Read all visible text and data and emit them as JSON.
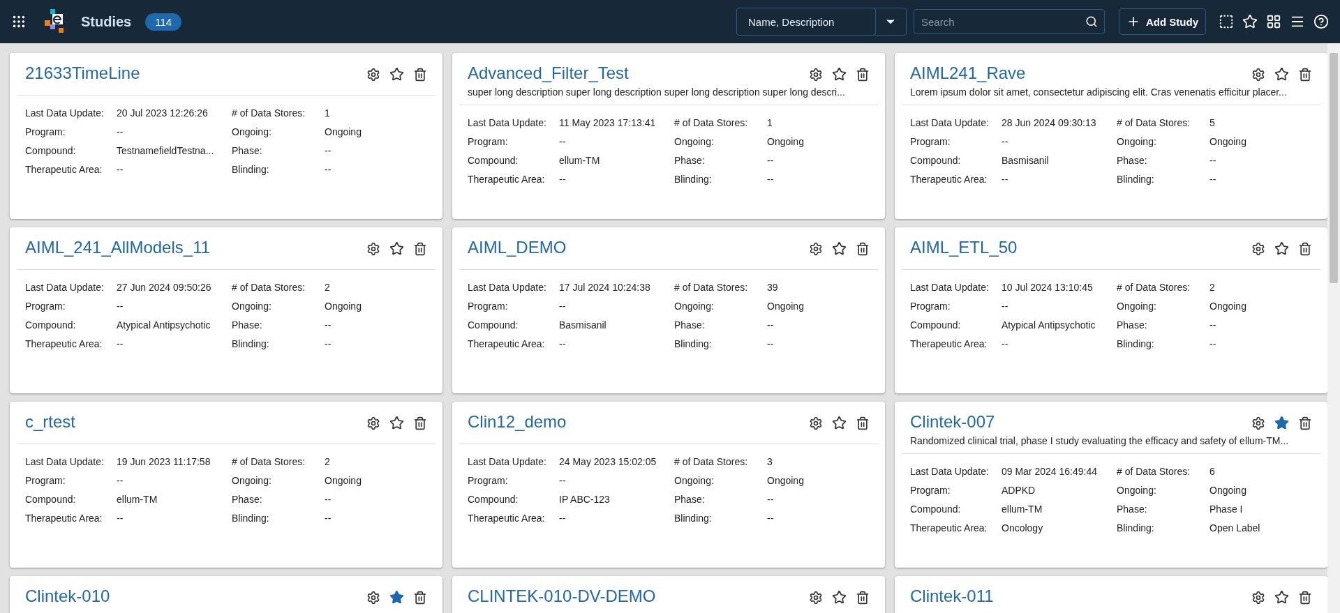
{
  "header": {
    "title": "Studies",
    "count": "114",
    "search_by": "Name, Description",
    "search": {
      "placeholder": "Search"
    },
    "add_button": "Add Study"
  },
  "cards": [
    {
      "title": "21633TimeLine",
      "favorite": false,
      "fields": [
        {
          "label": "Last Data Update:",
          "value": "20 Jul 2023 12:26:26"
        },
        {
          "label": "# of Data Stores:",
          "value": "1"
        },
        {
          "label": "Program:",
          "value": "--"
        },
        {
          "label": "Ongoing:",
          "value": "Ongoing"
        },
        {
          "label": "Compound:",
          "value": "TestnamefieldTestna..."
        },
        {
          "label": "Phase:",
          "value": "--"
        },
        {
          "label": "Therapeutic Area:",
          "value": "--"
        },
        {
          "label": "Blinding:",
          "value": "--"
        }
      ]
    },
    {
      "title": "Advanced_Filter_Test",
      "favorite": false,
      "description": "super long description super long description super long description super long descri...",
      "fields": [
        {
          "label": "Last Data Update:",
          "value": "11 May 2023 17:13:41"
        },
        {
          "label": "# of Data Stores:",
          "value": "1"
        },
        {
          "label": "Program:",
          "value": "--"
        },
        {
          "label": "Ongoing:",
          "value": "Ongoing"
        },
        {
          "label": "Compound:",
          "value": "ellum-TM"
        },
        {
          "label": "Phase:",
          "value": "--"
        },
        {
          "label": "Therapeutic Area:",
          "value": "--"
        },
        {
          "label": "Blinding:",
          "value": "--"
        }
      ]
    },
    {
      "title": "AIML241_Rave",
      "favorite": false,
      "description": "Lorem ipsum dolor sit amet, consectetur adipiscing elit. Cras venenatis efficitur placer...",
      "fields": [
        {
          "label": "Last Data Update:",
          "value": "28 Jun 2024 09:30:13"
        },
        {
          "label": "# of Data Stores:",
          "value": "5"
        },
        {
          "label": "Program:",
          "value": "--"
        },
        {
          "label": "Ongoing:",
          "value": "Ongoing"
        },
        {
          "label": "Compound:",
          "value": "Basmisanil"
        },
        {
          "label": "Phase:",
          "value": "--"
        },
        {
          "label": "Therapeutic Area:",
          "value": "--"
        },
        {
          "label": "Blinding:",
          "value": "--"
        }
      ]
    },
    {
      "title": "AIML_241_AllModels_11",
      "favorite": false,
      "fields": [
        {
          "label": "Last Data Update:",
          "value": "27 Jun 2024 09:50:26"
        },
        {
          "label": "# of Data Stores:",
          "value": "2"
        },
        {
          "label": "Program:",
          "value": "--"
        },
        {
          "label": "Ongoing:",
          "value": "Ongoing"
        },
        {
          "label": "Compound:",
          "value": "Atypical Antipsychotic"
        },
        {
          "label": "Phase:",
          "value": "--"
        },
        {
          "label": "Therapeutic Area:",
          "value": "--"
        },
        {
          "label": "Blinding:",
          "value": "--"
        }
      ]
    },
    {
      "title": "AIML_DEMO",
      "favorite": false,
      "fields": [
        {
          "label": "Last Data Update:",
          "value": "17 Jul 2024 10:24:38"
        },
        {
          "label": "# of Data Stores:",
          "value": "39"
        },
        {
          "label": "Program:",
          "value": "--"
        },
        {
          "label": "Ongoing:",
          "value": "Ongoing"
        },
        {
          "label": "Compound:",
          "value": "Basmisanil"
        },
        {
          "label": "Phase:",
          "value": "--"
        },
        {
          "label": "Therapeutic Area:",
          "value": "--"
        },
        {
          "label": "Blinding:",
          "value": "--"
        }
      ]
    },
    {
      "title": "AIML_ETL_50",
      "favorite": false,
      "fields": [
        {
          "label": "Last Data Update:",
          "value": "10 Jul 2024 13:10:45"
        },
        {
          "label": "# of Data Stores:",
          "value": "2"
        },
        {
          "label": "Program:",
          "value": "--"
        },
        {
          "label": "Ongoing:",
          "value": "Ongoing"
        },
        {
          "label": "Compound:",
          "value": "Atypical Antipsychotic"
        },
        {
          "label": "Phase:",
          "value": "--"
        },
        {
          "label": "Therapeutic Area:",
          "value": "--"
        },
        {
          "label": "Blinding:",
          "value": "--"
        }
      ]
    },
    {
      "title": "c_rtest",
      "favorite": false,
      "fields": [
        {
          "label": "Last Data Update:",
          "value": "19 Jun 2023 11:17:58"
        },
        {
          "label": "# of Data Stores:",
          "value": "2"
        },
        {
          "label": "Program:",
          "value": "--"
        },
        {
          "label": "Ongoing:",
          "value": "Ongoing"
        },
        {
          "label": "Compound:",
          "value": "ellum-TM"
        },
        {
          "label": "Phase:",
          "value": "--"
        },
        {
          "label": "Therapeutic Area:",
          "value": "--"
        },
        {
          "label": "Blinding:",
          "value": "--"
        }
      ]
    },
    {
      "title": "Clin12_demo",
      "favorite": false,
      "fields": [
        {
          "label": "Last Data Update:",
          "value": "24 May 2023 15:02:05"
        },
        {
          "label": "# of Data Stores:",
          "value": "3"
        },
        {
          "label": "Program:",
          "value": "--"
        },
        {
          "label": "Ongoing:",
          "value": "Ongoing"
        },
        {
          "label": "Compound:",
          "value": "IP ABC-123"
        },
        {
          "label": "Phase:",
          "value": "--"
        },
        {
          "label": "Therapeutic Area:",
          "value": "--"
        },
        {
          "label": "Blinding:",
          "value": "--"
        }
      ]
    },
    {
      "title": "Clintek-007",
      "favorite": true,
      "description": "Randomized clinical trial, phase I study evaluating the efficacy and safety of ellum-TM...",
      "fields": [
        {
          "label": "Last Data Update:",
          "value": "09 Mar 2024 16:49:44"
        },
        {
          "label": "# of Data Stores:",
          "value": "6"
        },
        {
          "label": "Program:",
          "value": "ADPKD"
        },
        {
          "label": "Ongoing:",
          "value": "Ongoing"
        },
        {
          "label": "Compound:",
          "value": "ellum-TM"
        },
        {
          "label": "Phase:",
          "value": "Phase I"
        },
        {
          "label": "Therapeutic Area:",
          "value": "Oncology"
        },
        {
          "label": "Blinding:",
          "value": "Open Label"
        }
      ]
    },
    {
      "title": "Clintek-010",
      "favorite": true
    },
    {
      "title": "CLINTEK-010-DV-DEMO",
      "favorite": false
    },
    {
      "title": "Clintek-011",
      "favorite": false
    }
  ]
}
